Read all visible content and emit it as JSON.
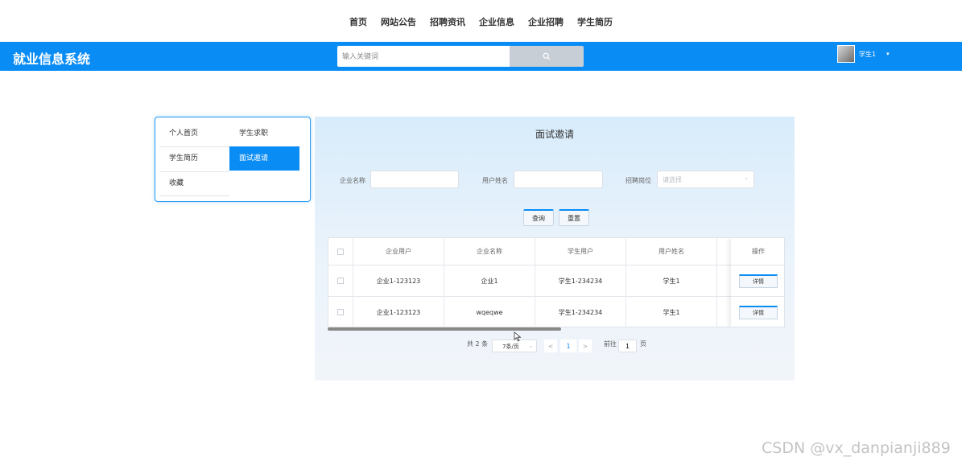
{
  "nav": {
    "items": [
      "首页",
      "网站公告",
      "招聘资讯",
      "企业信息",
      "企业招聘",
      "学生简历"
    ]
  },
  "header": {
    "brand": "就业信息系统",
    "search_placeholder": "输入关键词",
    "user_name": "学生1",
    "accent": "#0a8cf5"
  },
  "sidebar": {
    "items": [
      {
        "label": "个人首页"
      },
      {
        "label": "学生求职"
      },
      {
        "label": "学生简历"
      },
      {
        "label": "面试邀请",
        "active": true
      },
      {
        "label": "收藏"
      }
    ]
  },
  "main": {
    "title": "面试邀请",
    "filters": {
      "company_name_label": "企业名称",
      "user_name_label": "用户姓名",
      "position_label": "招聘岗位",
      "position_placeholder": "请选择"
    },
    "buttons": {
      "query": "查询",
      "reset": "重置"
    },
    "table": {
      "headers": [
        "企业用户",
        "企业名称",
        "学生用户",
        "用户姓名",
        "操作"
      ],
      "rows": [
        {
          "company_user": "企业1-123123",
          "company_name": "企业1",
          "student_user": "学生1-234234",
          "user_name": "学生1",
          "action": "详情"
        },
        {
          "company_user": "企业1-123123",
          "company_name": "wqeqwe",
          "student_user": "学生1-234234",
          "user_name": "学生1",
          "action": "详情"
        }
      ]
    },
    "pagination": {
      "total": "共 2 条",
      "page_size": "7条/页",
      "prev": "<",
      "current_page": "1",
      "next": ">",
      "goto_label": "前往",
      "goto_value": "1",
      "page_suffix": "页"
    }
  },
  "watermark": "CSDN @vx_danpianji889"
}
